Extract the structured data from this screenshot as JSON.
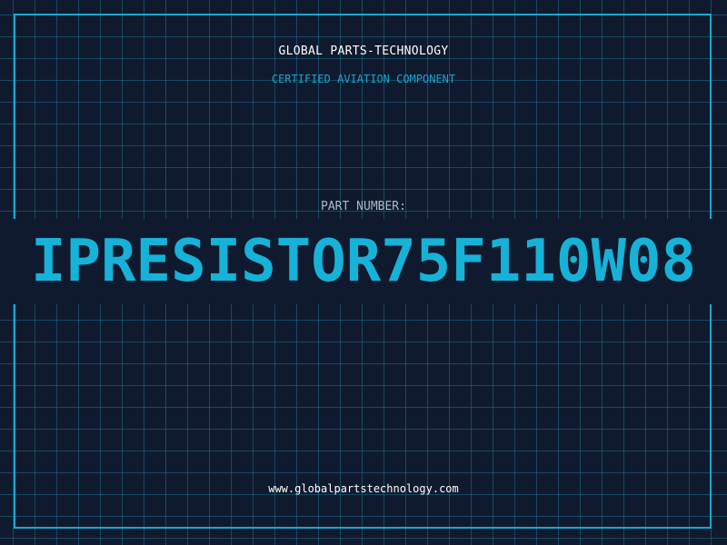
{
  "header": {
    "company": "GLOBAL PARTS-TECHNOLOGY",
    "subtitle": "CERTIFIED AVIATION COMPONENT"
  },
  "part": {
    "label": "PART NUMBER:",
    "number": "IPRESISTOR75F110W08"
  },
  "footer": {
    "website": "www.globalpartstechnology.com"
  },
  "colors": {
    "background": "#101a2e",
    "accent": "#16b2d8",
    "grid": "#1e6e8c"
  }
}
